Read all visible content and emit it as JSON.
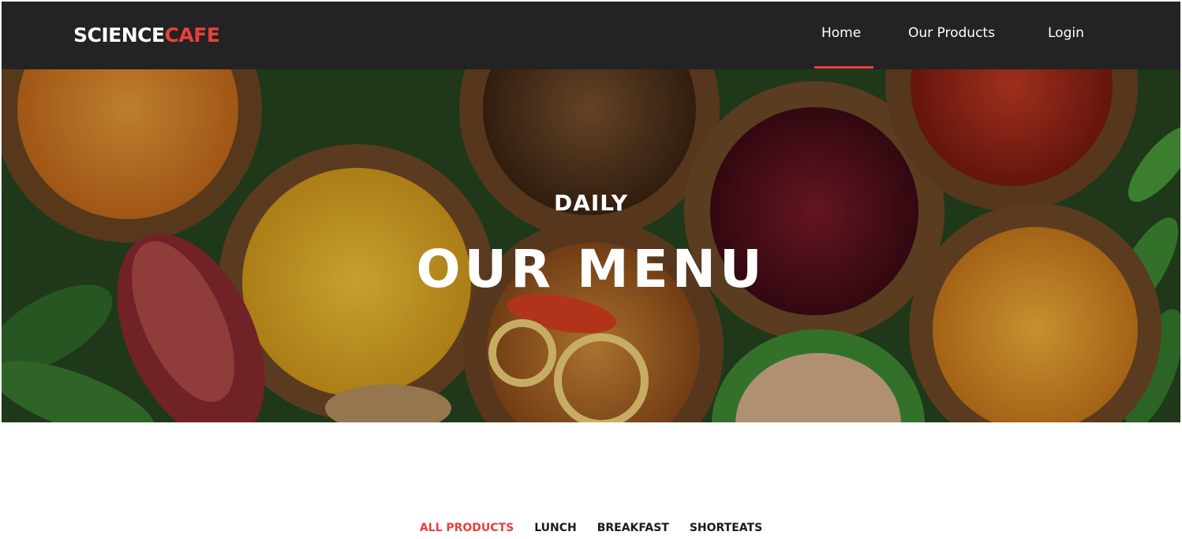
{
  "brand": {
    "part1": "SCIENCE",
    "part2": "CAFE",
    "accent_color": "#e8403b"
  },
  "nav": {
    "home": "Home",
    "products": "Our Products",
    "login": "Login",
    "active": "home"
  },
  "hero": {
    "kicker": "DAILY",
    "title": "OUR MENU",
    "background": "food-bowls-photo"
  },
  "filters": {
    "items": [
      "ALL PRODUCTS",
      "LUNCH",
      "BREAKFAST",
      "SHORTEATS"
    ],
    "active_index": 0
  }
}
